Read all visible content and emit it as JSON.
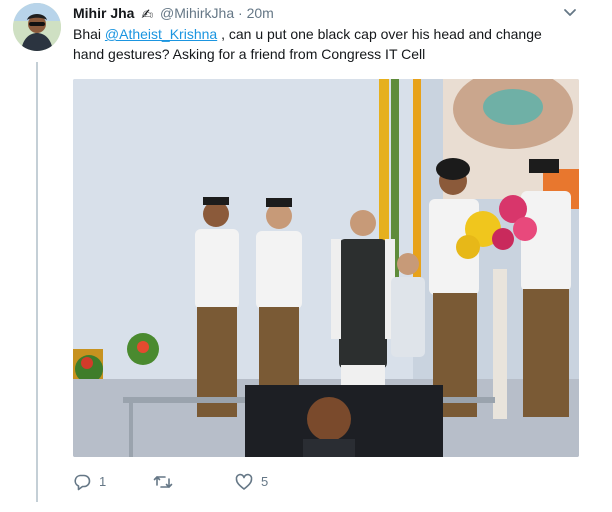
{
  "tweet": {
    "author_name": "Mihir Jha",
    "author_emoji": "✍",
    "handle": "@MihirkJha",
    "separator": "·",
    "time": "20m",
    "text_before_mention": "Bhai ",
    "mention": "@Atheist_Krishna",
    "text_after_mention": " , can u put one black cap over his head and change hand gestures? Asking for a friend from Congress IT Cell"
  },
  "actions": {
    "reply_count": "1",
    "retweet_count": "",
    "like_count": "5"
  },
  "icons": {
    "avatar": "profile-photo",
    "caret": "chevron-down-icon",
    "reply": "reply-icon",
    "retweet": "retweet-icon",
    "like": "heart-icon"
  },
  "colors": {
    "link": "#1b95e0",
    "secondary_text": "#657786",
    "primary_text": "#14171a",
    "thread_line": "#c4cfd6"
  }
}
